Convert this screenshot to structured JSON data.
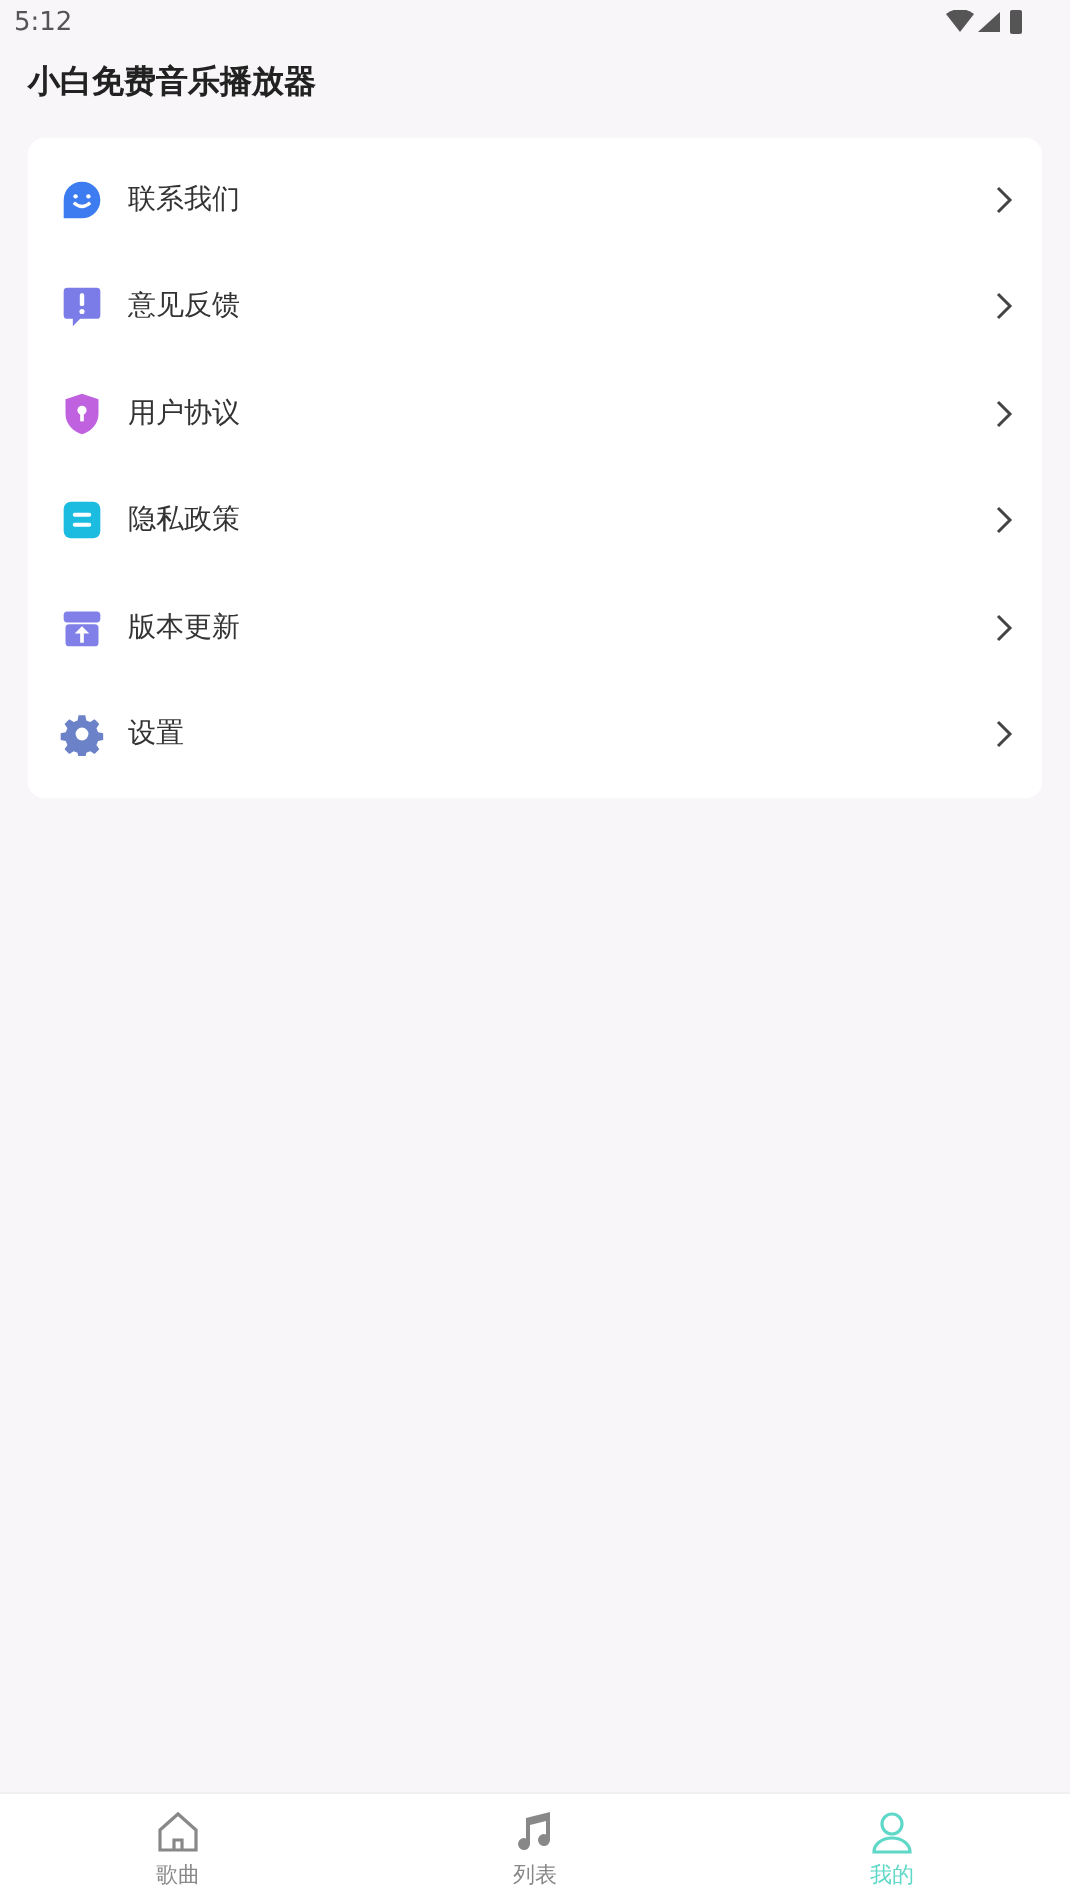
{
  "status_bar": {
    "time": "5:12"
  },
  "app_bar": {
    "title": "小白免费音乐播放器"
  },
  "menu": [
    {
      "label": "联系我们",
      "kind": "smile",
      "color": "#3d7cf0"
    },
    {
      "label": "意见反馈",
      "kind": "feedback",
      "color": "#7c7ce8"
    },
    {
      "label": "用户协议",
      "kind": "shield",
      "color": "#c062e0"
    },
    {
      "label": "隐私政策",
      "kind": "doc",
      "color": "#1cbbe0"
    },
    {
      "label": "版本更新",
      "kind": "gift",
      "color": "#8080e8"
    },
    {
      "label": "设置",
      "kind": "gear",
      "color": "#6c82c8"
    }
  ],
  "tabs": [
    {
      "label": "歌曲",
      "kind": "home",
      "selected": false
    },
    {
      "label": "列表",
      "kind": "music",
      "selected": false
    },
    {
      "label": "我的",
      "kind": "user",
      "selected": true
    }
  ]
}
